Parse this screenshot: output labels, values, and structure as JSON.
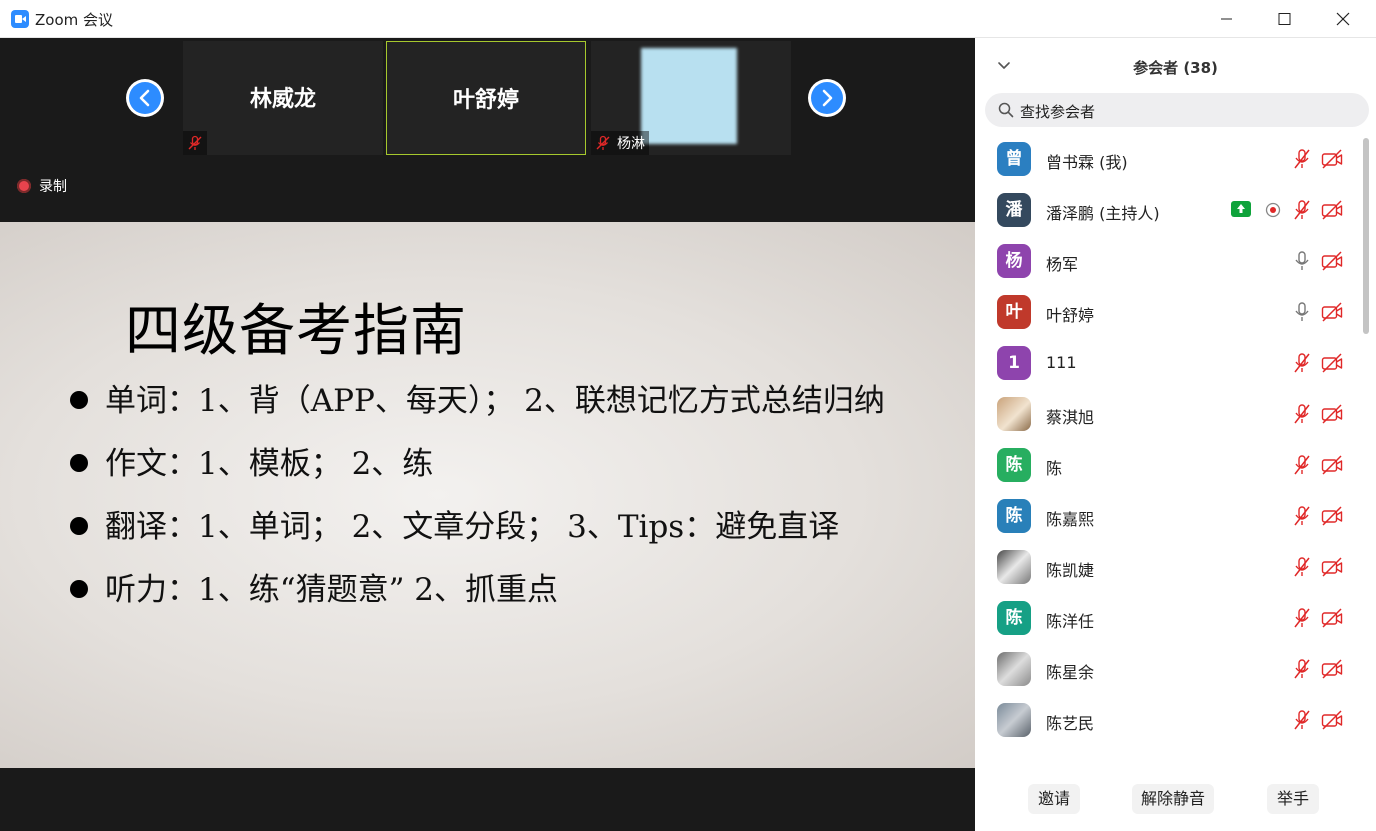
{
  "window": {
    "title": "Zoom 会议"
  },
  "video_strip": {
    "tiles": [
      {
        "name": "林威龙"
      },
      {
        "name": "叶舒婷"
      },
      {
        "name": "杨淋"
      }
    ],
    "recording_label": "录制"
  },
  "slide": {
    "title": "四级备考指南",
    "bullets": [
      "单词：1、背（APP、每天）；  2、联想记忆方式总结归纳",
      "作文：1、模板；  2、练",
      "翻译：1、单词；  2、文章分段；  3、Tips：避免直译",
      "听力：1、练“猜题意”  2、抓重点"
    ]
  },
  "panel": {
    "title": "参会者 (38)",
    "search_placeholder": "查找参会者",
    "participants": [
      {
        "name": "曾书霖 (我)",
        "avatar": "曾",
        "color": "#2b7fc1",
        "mic": "muted"
      },
      {
        "name": "潘泽鹏 (主持人)",
        "avatar": "潘",
        "color": "#34495e",
        "mic": "muted",
        "sharing": true,
        "recording": true
      },
      {
        "name": "杨军",
        "avatar": "杨",
        "color": "#8e44ad",
        "mic": "on"
      },
      {
        "name": "叶舒婷",
        "avatar": "叶",
        "color": "#c0392b",
        "mic": "on"
      },
      {
        "name": "111",
        "avatar": "1",
        "color": "#8e44ad",
        "mic": "muted"
      },
      {
        "name": "蔡淇旭",
        "avatar": "",
        "color": "",
        "mic": "muted"
      },
      {
        "name": "陈",
        "avatar": "陈",
        "color": "#27ae60",
        "mic": "muted"
      },
      {
        "name": "陈嘉熙",
        "avatar": "陈",
        "color": "#2980b9",
        "mic": "muted"
      },
      {
        "name": "陈凯婕",
        "avatar": "",
        "color": "",
        "mic": "muted"
      },
      {
        "name": "陈洋任",
        "avatar": "陈",
        "color": "#16a085",
        "mic": "muted"
      },
      {
        "name": "陈星余",
        "avatar": "",
        "color": "",
        "mic": "muted"
      },
      {
        "name": "陈艺民",
        "avatar": "",
        "color": "",
        "mic": "muted"
      }
    ],
    "buttons": {
      "invite": "邀请",
      "unmute_all": "解除静音",
      "raise_hand": "举手"
    }
  },
  "colors": {
    "accent": "#2d8cff",
    "muted_red": "#e02828",
    "share_green": "#0fa33b"
  }
}
